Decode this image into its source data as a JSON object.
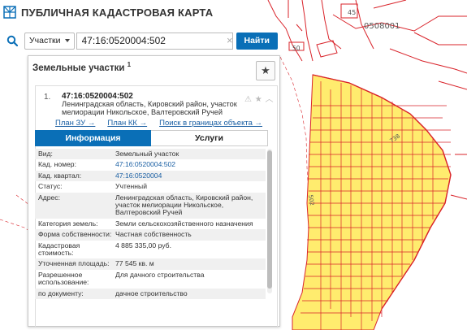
{
  "app": {
    "title": "ПУБЛИЧНАЯ КАДАСТРОВАЯ КАРТА"
  },
  "search": {
    "type_label": "Участки",
    "query": "47:16:0520004:502",
    "find_label": "Найти"
  },
  "panel": {
    "heading": "Земельные участки",
    "count": "1"
  },
  "result": {
    "index": "1.",
    "cad_number": "47:16:0520004:502",
    "address": "Ленинградская область, Кировский район, участок мелиорации Никольское, Валтеровский Ручей",
    "links": [
      "План ЗУ →",
      "План КК →",
      "Поиск в границах объекта →"
    ]
  },
  "tabs": [
    "Информация",
    "Услуги"
  ],
  "properties": [
    {
      "key": "Вид:",
      "value": "Земельный участок"
    },
    {
      "key": "Кад. номер:",
      "value": "47:16:0520004:502",
      "link": true
    },
    {
      "key": "Кад. квартал:",
      "value": "47:16:0520004",
      "link": true
    },
    {
      "key": "Статус:",
      "value": "Учтенный"
    },
    {
      "key": "Адрес:",
      "value": "Ленинградская область, Кировский район, участок мелиорации Никольское, Валтеровский Ручей"
    },
    {
      "key": "Категория земель:",
      "value": "Земли сельскохозяйственного назначения"
    },
    {
      "key": "Форма собственности:",
      "value": "Частная собственность"
    },
    {
      "key": "Кадастровая стоимость:",
      "value": "4 885 335,00 руб."
    },
    {
      "key": "Уточненная площадь:",
      "value": "77 545 кв. м"
    },
    {
      "key": "Разрешенное использование:",
      "value": "Для дачного строительства"
    },
    {
      "key": "по документу:",
      "value": "дачное строительство"
    }
  ],
  "map_labels": {
    "quarter": "0508001",
    "lot_a": "45",
    "lot_b": "50",
    "lot_c": "738",
    "lot_d": "502"
  },
  "colors": {
    "accent": "#0a6fb7",
    "boundary": "#d9232a",
    "parcel_fill": "#ffec6e"
  }
}
